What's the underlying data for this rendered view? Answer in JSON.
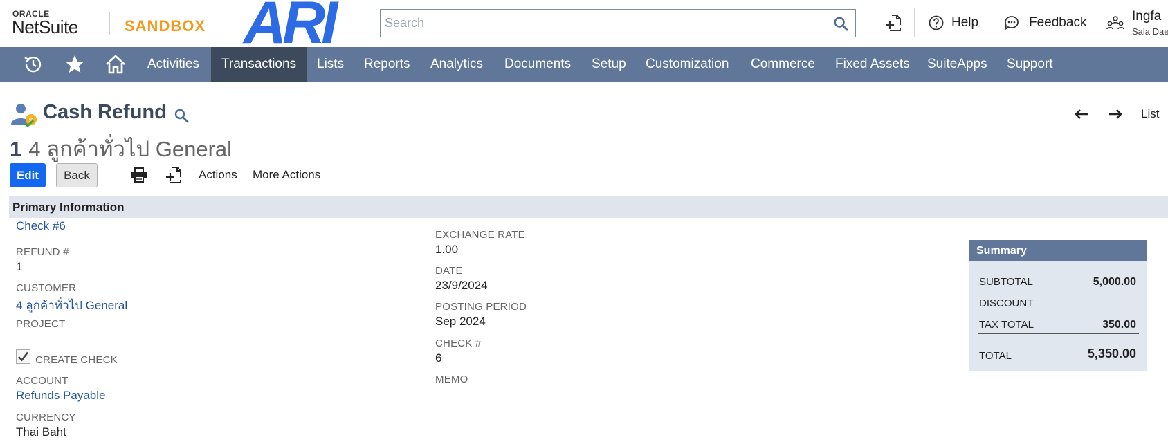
{
  "header": {
    "oracle": "ORACLE",
    "netsuite": "NetSuite",
    "sandbox": "SANDBOX",
    "brand_mark": "ARI",
    "search_placeholder": "Search",
    "help": "Help",
    "feedback": "Feedback",
    "user_name": "Ingfa",
    "user_sub": "Sala Dae"
  },
  "nav": {
    "icons": [
      "recent-records-icon",
      "star-icon",
      "home-icon"
    ],
    "items": [
      "Activities",
      "Transactions",
      "Lists",
      "Reports",
      "Analytics",
      "Documents",
      "Setup",
      "Customization",
      "Commerce",
      "Fixed Assets",
      "SuiteApps",
      "Support"
    ],
    "active": "Transactions"
  },
  "page": {
    "title": "Cash Refund",
    "record_number": "1",
    "record_name_prefix": "4 ลูกค้าทั่วไป",
    "record_name_suffix": "General",
    "list_link": "List"
  },
  "toolbar": {
    "edit": "Edit",
    "back": "Back",
    "actions": "Actions",
    "more_actions": "More Actions"
  },
  "primary": {
    "section_title": "Primary Information",
    "check_link": "Check #6",
    "refund_label": "REFUND #",
    "refund_value": "1",
    "customer_label": "CUSTOMER",
    "customer_value": "4 ลูกค้าทั่วไป General",
    "project_label": "PROJECT",
    "create_check_label": "CREATE CHECK",
    "create_check_checked": true,
    "account_label": "ACCOUNT",
    "account_value": "Refunds Payable",
    "currency_label": "CURRENCY",
    "currency_value": "Thai Baht",
    "exchange_rate_label": "EXCHANGE RATE",
    "exchange_rate_value": "1.00",
    "date_label": "DATE",
    "date_value": "23/9/2024",
    "posting_period_label": "POSTING PERIOD",
    "posting_period_value": "Sep 2024",
    "check_num_label": "CHECK #",
    "check_num_value": "6",
    "memo_label": "MEMO"
  },
  "summary": {
    "title": "Summary",
    "subtotal_label": "SUBTOTAL",
    "subtotal_value": "5,000.00",
    "discount_label": "DISCOUNT",
    "tax_label": "TAX TOTAL",
    "tax_value": "350.00",
    "total_label": "TOTAL",
    "total_value": "5,350.00"
  },
  "colors": {
    "nav_bg": "#607799",
    "nav_active": "#3c4a5c",
    "edit_button": "#1467f0",
    "sandbox": "#f39a1e",
    "brand_mark": "#2d6be4",
    "link": "#24549c",
    "section_bg": "#e0e5ed"
  }
}
